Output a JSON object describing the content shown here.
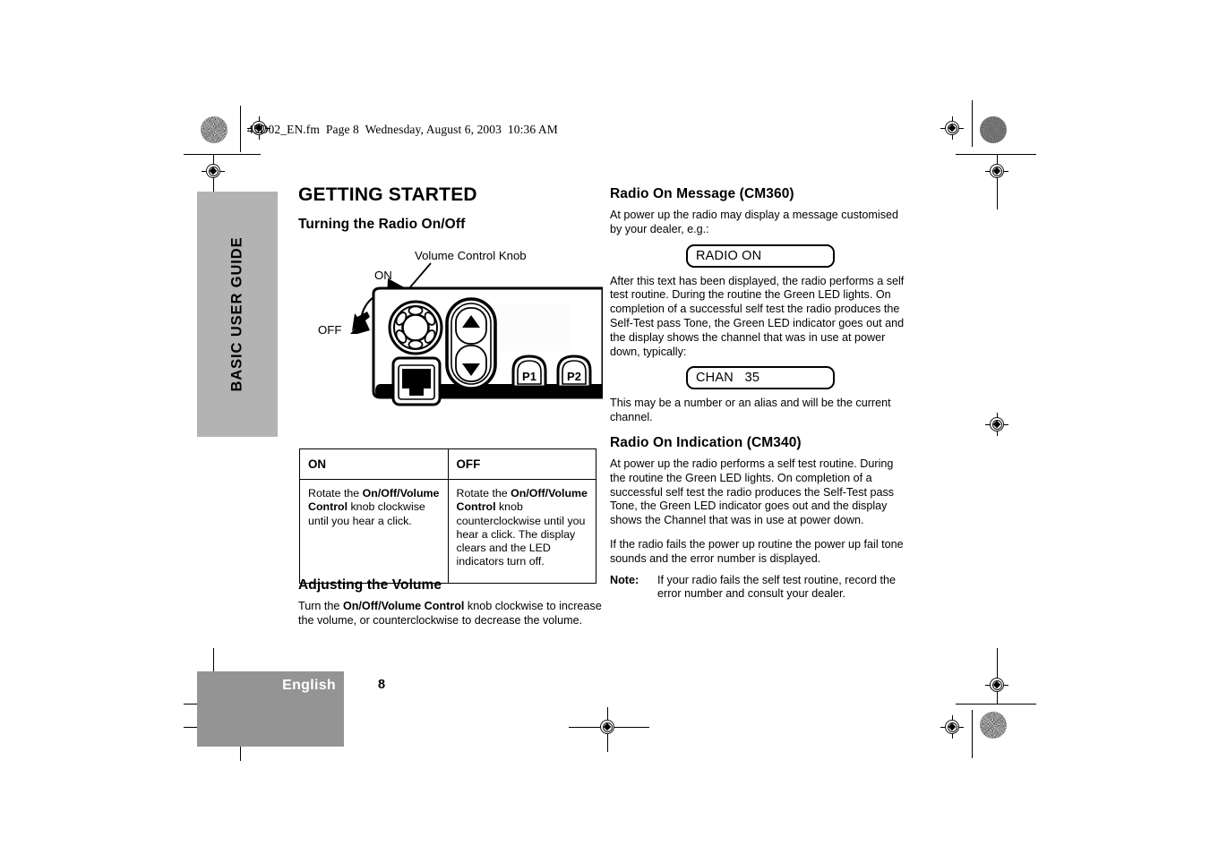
{
  "file_header": "45D02_EN.fm  Page 8  Wednesday, August 6, 2003  10:36 AM",
  "side_tab": {
    "label": "BASIC USER GUIDE"
  },
  "left_column": {
    "title": "GETTING STARTED",
    "section_1": {
      "heading": "Turning the Radio On/Off"
    },
    "figure": {
      "volume_knob_label": "Volume Control Knob",
      "on_label": "ON",
      "off_label": "OFF",
      "button_p1": "P1",
      "button_p2": "P2"
    },
    "table": {
      "header_on": "ON",
      "header_off": "OFF",
      "cell_on_prefix": "Rotate the ",
      "cell_on_bold": "On/Off/Volume Control",
      "cell_on_suffix": " knob clockwise until you hear a click.",
      "cell_off_prefix": "Rotate the ",
      "cell_off_bold": "On/Off/Volume Control",
      "cell_off_suffix": " knob counterclockwise until you hear a click. The display clears and the LED indicators turn off."
    },
    "section_2": {
      "heading": "Adjusting the Volume",
      "text_prefix": "Turn the ",
      "text_bold": "On/Off/Volume Control",
      "text_suffix": " knob clockwise to increase the volume, or counterclockwise to decrease the volume."
    }
  },
  "right_column": {
    "section_1": {
      "heading": "Radio On Message (CM360)",
      "para_1": "At power up the radio may display a message customised by your dealer, e.g.:",
      "display_1": "RADIO ON",
      "para_2": "After this text has been displayed, the radio performs a self test routine. During the routine the Green LED lights. On completion of a successful self test the radio produces the Self-Test pass Tone, the Green LED indicator goes out and the display shows the channel that was in use at power down, typically:",
      "display_2": "CHAN   35",
      "para_3": "This may be a number or an alias and will be the current channel."
    },
    "section_2": {
      "heading": "Radio On Indication (CM340)",
      "para_1": "At power up the radio performs a self test routine. During the routine the Green LED lights. On completion of a successful self test the radio produces the Self-Test pass Tone, the Green LED indicator goes out and the display shows the Channel that was in use at power down.",
      "para_2": "If the radio fails the power up routine the power up fail tone sounds and the error number is displayed.",
      "note_label": "Note:",
      "note_text": "If your radio fails the self test routine, record the error number and consult your dealer."
    }
  },
  "footer": {
    "language": "English",
    "page_number": "8"
  },
  "colors": {
    "side_tab_gray": "#b3b3b3",
    "footer_gray": "#949494",
    "ink": "#000000",
    "paper": "#ffffff"
  }
}
